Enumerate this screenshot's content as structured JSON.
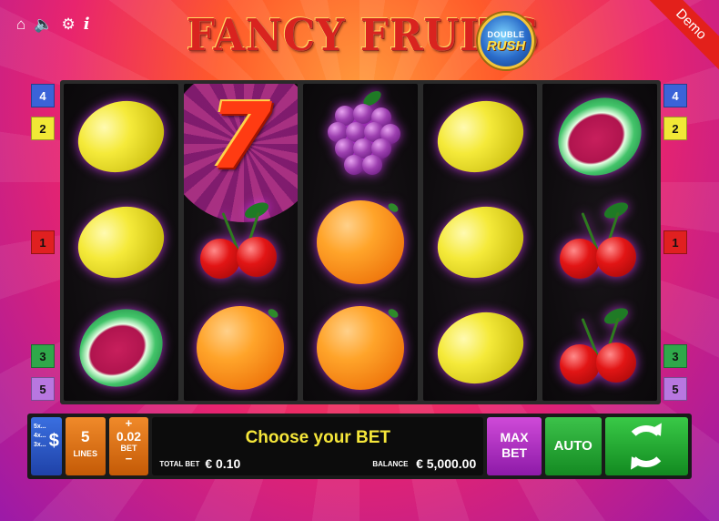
{
  "top_icons": [
    {
      "name": "home-icon",
      "glyph": "⌂"
    },
    {
      "name": "sound-icon",
      "glyph": "🔈"
    },
    {
      "name": "gear-icon",
      "glyph": "⚙"
    },
    {
      "name": "info-icon",
      "glyph": "i"
    }
  ],
  "logo": {
    "title": "FANCY FRUITS",
    "badge_line1": "DOUBLE",
    "badge_line2": "RUSH"
  },
  "demo_label": "Demo",
  "reels": [
    [
      "lemon",
      "lemon",
      "watermelon"
    ],
    [
      "seven",
      "cherries",
      "orange"
    ],
    [
      "grapes",
      "orange",
      "orange"
    ],
    [
      "lemon",
      "lemon",
      "lemon"
    ],
    [
      "watermelon",
      "cherries",
      "cherries"
    ]
  ],
  "line_markers": {
    "left": [
      {
        "label": "4",
        "color": "#3b63d8"
      },
      {
        "label": "2",
        "color": "#f1e836"
      },
      {
        "label": "1",
        "color": "#e02020"
      },
      {
        "label": "3",
        "color": "#2fa84a"
      },
      {
        "label": "5",
        "color": "#b877e0"
      }
    ],
    "right": [
      {
        "label": "4",
        "color": "#3b63d8"
      },
      {
        "label": "2",
        "color": "#f1e836"
      },
      {
        "label": "1",
        "color": "#e02020"
      },
      {
        "label": "3",
        "color": "#2fa84a"
      },
      {
        "label": "5",
        "color": "#b877e0"
      }
    ]
  },
  "controls": {
    "paytable": {
      "lines": [
        "5x...",
        "4x...",
        "3x..."
      ],
      "symbol": "$"
    },
    "lines": {
      "value": "5",
      "label": "LINES"
    },
    "bet": {
      "plus": "+",
      "value": "0.02",
      "label": "BET",
      "minus": "−"
    },
    "message": "Choose your BET",
    "total_bet_label": "TOTAL BET",
    "total_bet_value": "€ 0.10",
    "balance_label": "BALANCE",
    "balance_value": "€ 5,000.00",
    "max_bet_line1": "MAX",
    "max_bet_line2": "BET",
    "auto_label": "AUTO"
  },
  "colors": {
    "accent_yellow": "#f6e73a",
    "spin_green": "#39c947",
    "max_bet_purple": "#cf4ad8",
    "lines_orange": "#f08a2a",
    "paytable_blue": "#3a6fe0"
  }
}
